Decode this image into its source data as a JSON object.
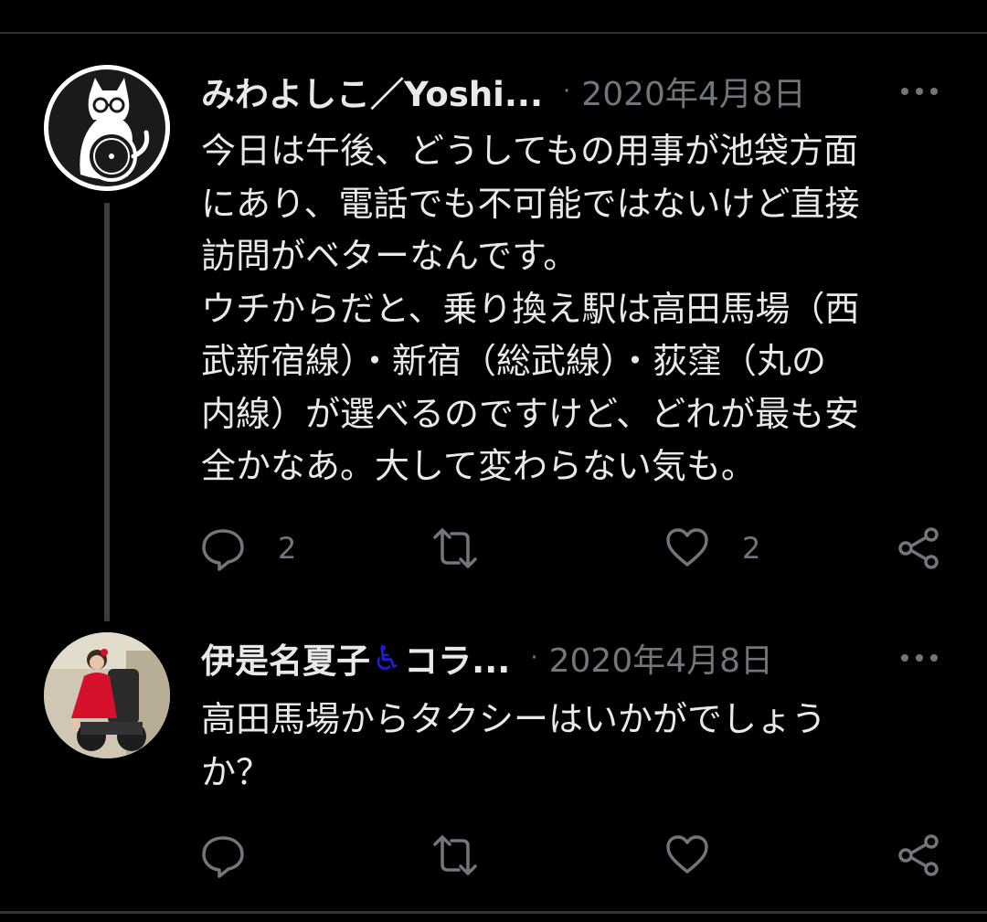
{
  "tweets": [
    {
      "display_name": "みわよしこ／Yoshi...",
      "separator": "·",
      "timestamp": "2020年4月8日",
      "avatar_icon": "cat-wheelchair-icon",
      "text": "今日は午後、どうしてもの用事が池袋方面\nにあり、電話でも不可能ではないけど直接\n訪問がベターなんです。\nウチからだと、乗り換え駅は高田馬場（西\n武新宿線）・新宿（総武線）・荻窪（丸の\n内線）が選べるのですけど、どれが最も安\n全かなあ。大して変わらない気も。",
      "reply_count": "2",
      "retweet_count": "",
      "like_count": "2"
    },
    {
      "display_name": "伊是名夏子",
      "name_emoji": "♿",
      "name_suffix": "コラ...",
      "separator": "·",
      "timestamp": "2020年4月8日",
      "avatar_icon": "person-photo-avatar",
      "text": "高田馬場からタクシーはいかがでしょう\nか？",
      "reply_count": "",
      "retweet_count": "",
      "like_count": ""
    }
  ],
  "colors": {
    "background": "#000000",
    "text": "#e7e9ea",
    "secondary": "#71767b",
    "divider": "#2f3336",
    "accessibility_blue": "#1d1dd6"
  }
}
